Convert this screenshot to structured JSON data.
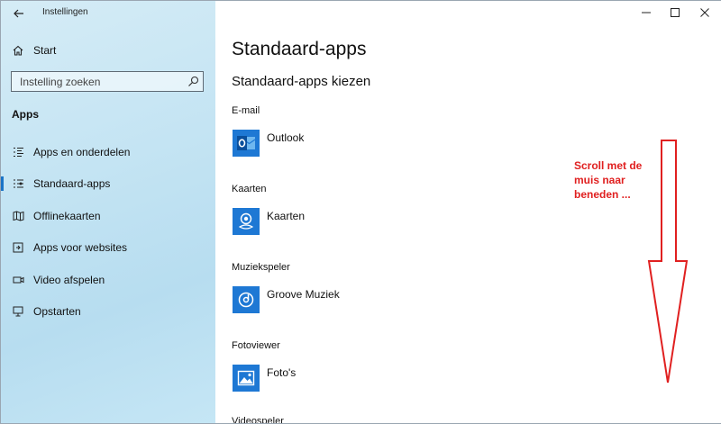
{
  "window": {
    "title": "Instellingen",
    "controls": {
      "minimize": "—",
      "maximize": "☐",
      "close": "✕"
    }
  },
  "sidebar": {
    "home_label": "Start",
    "search_placeholder": "Instelling zoeken",
    "section_header": "Apps",
    "items": [
      {
        "label": "Apps en onderdelen",
        "icon": "list-icon"
      },
      {
        "label": "Standaard-apps",
        "icon": "default-apps-icon",
        "selected": true
      },
      {
        "label": "Offlinekaarten",
        "icon": "map-icon"
      },
      {
        "label": "Apps voor websites",
        "icon": "web-apps-icon"
      },
      {
        "label": "Video afspelen",
        "icon": "video-icon"
      },
      {
        "label": "Opstarten",
        "icon": "startup-icon"
      }
    ]
  },
  "main": {
    "title": "Standaard-apps",
    "subtitle": "Standaard-apps kiezen",
    "categories": [
      {
        "label": "E-mail",
        "app": "Outlook",
        "icon": "outlook-icon"
      },
      {
        "label": "Kaarten",
        "app": "Kaarten",
        "icon": "maps-app-icon"
      },
      {
        "label": "Muziekspeler",
        "app": "Groove Muziek",
        "icon": "groove-music-icon"
      },
      {
        "label": "Fotoviewer",
        "app": "Foto's",
        "icon": "photos-icon"
      },
      {
        "label": "Videospeler"
      }
    ]
  },
  "annotation": {
    "text": "Scroll met de muis naar beneden ...",
    "color": "#e02020"
  },
  "colors": {
    "accent": "#1e78d4",
    "selection_bar": "#1a73c7"
  }
}
